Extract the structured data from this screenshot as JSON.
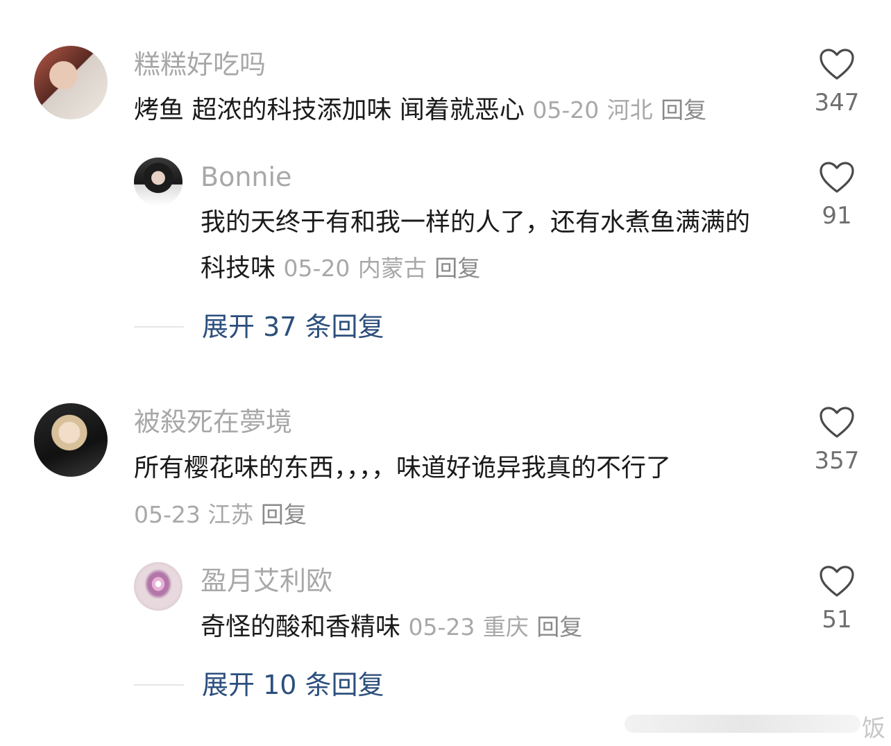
{
  "comments": [
    {
      "username": "糕糕好吃吗",
      "text": "烤鱼 超浓的科技添加味 闻着就恶心",
      "date": "05-20",
      "location": "河北",
      "reply_label": "回复",
      "likes": "347",
      "replies": [
        {
          "username": "Bonnie",
          "text": "我的天终于有和我一样的人了，还有水煮鱼满满的科技味",
          "date": "05-20",
          "location": "内蒙古",
          "reply_label": "回复",
          "likes": "91"
        }
      ],
      "expand_label": "展开 37 条回复"
    },
    {
      "username": "被殺死在夢境",
      "text": "所有樱花味的东西，，，，味道好诡异我真的不行了",
      "date": "05-23",
      "location": "江苏",
      "reply_label": "回复",
      "likes": "357",
      "replies": [
        {
          "username": "盈月艾利欧",
          "text": "奇怪的酸和香精味",
          "date": "05-23",
          "location": "重庆",
          "reply_label": "回复",
          "likes": "51"
        }
      ],
      "expand_label": "展开 10 条回复"
    }
  ],
  "watermark": "饭"
}
